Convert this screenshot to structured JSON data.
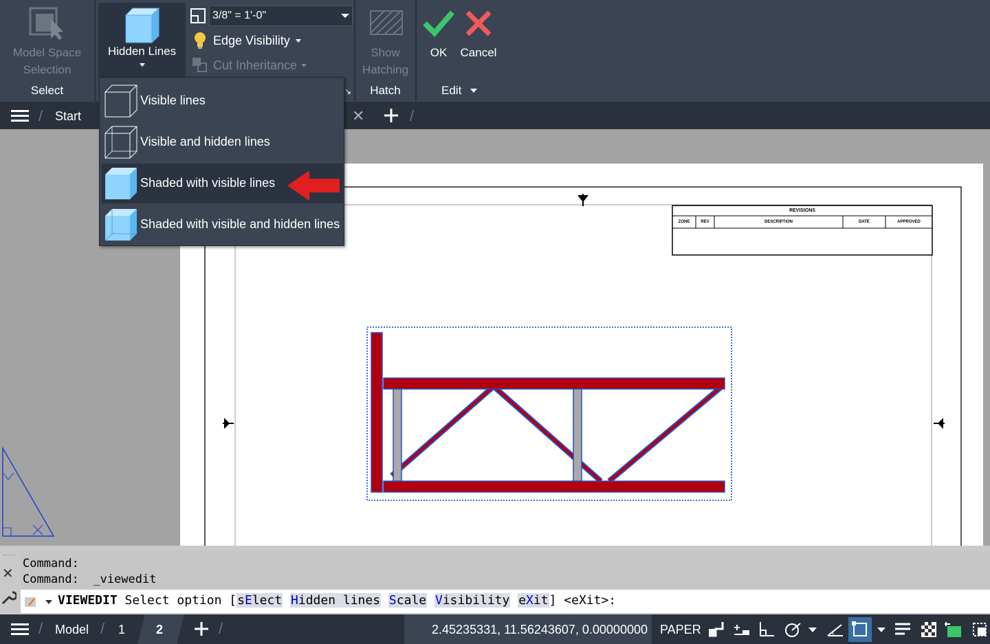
{
  "ribbon": {
    "select_panel": {
      "button_line1": "Model Space",
      "button_line2": "Selection",
      "panel_label": "Select"
    },
    "hidden_lines_button": "Hidden Lines",
    "scale_value": "3/8\" = 1'-0\"",
    "edge_visibility": "Edge Visibility",
    "cut_inheritance": "Cut Inheritance",
    "hatch_panel": {
      "button_line1": "Show",
      "button_line2": "Hatching",
      "panel_label": "Hatch"
    },
    "ok_label": "OK",
    "cancel_label": "Cancel",
    "edit_panel_label": "Edit"
  },
  "tabs": {
    "start": "Start"
  },
  "hidden_lines_menu": {
    "items": [
      {
        "label": "Visible lines",
        "icon": "wireframe-cube-icon"
      },
      {
        "label": "Visible and hidden lines",
        "icon": "hidden-lines-cube-icon"
      },
      {
        "label": "Shaded with visible lines",
        "icon": "shaded-cube-icon",
        "highlighted": true
      },
      {
        "label": "Shaded with visible and hidden lines",
        "icon": "shaded-hidden-cube-icon"
      }
    ]
  },
  "title_block": {
    "revisions": "REVISIONS",
    "columns": [
      "ZONE",
      "REV",
      "DESCRIPTION",
      "DATE",
      "APPROVED"
    ]
  },
  "command": {
    "history": [
      "Command:",
      "Command:  _viewedit"
    ],
    "prompt_name": "VIEWEDIT",
    "prompt_text": "Select option",
    "options": [
      {
        "hot": "",
        "rest_pre": "s",
        "key": "E",
        "rest": "lect"
      },
      {
        "hot": "H",
        "rest_pre": "",
        "key": "",
        "rest": "idden lines"
      },
      {
        "hot": "S",
        "rest_pre": "",
        "key": "",
        "rest": "cale"
      },
      {
        "hot": "V",
        "rest_pre": "",
        "key": "",
        "rest": "isibility"
      },
      {
        "hot": "",
        "rest_pre": "e",
        "key": "X",
        "rest": "it"
      }
    ],
    "default": "<eXit>:"
  },
  "statusbar": {
    "tabs": [
      "Model",
      "1",
      "2"
    ],
    "active_tab": "2",
    "coordinates": "2.45235331, 11.56243607, 0.00000000",
    "space": "PAPER"
  },
  "colors": {
    "ribbon_bg": "#3b4453",
    "dark_bg": "#2a313c",
    "accent_red": "#e02020",
    "ok_green": "#3cc56c",
    "beam_red": "#b00010",
    "shaded_blue": "#8fd3ff"
  }
}
